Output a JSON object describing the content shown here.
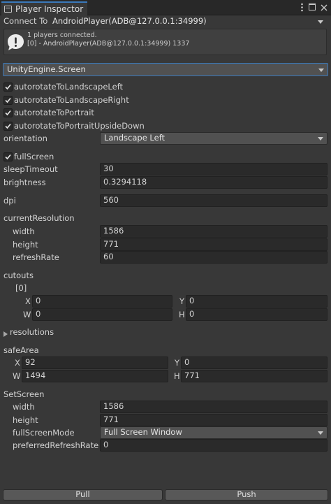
{
  "window": {
    "tab_title": "Player Inspector",
    "menu_icon": "kebab-menu-icon",
    "maximize_icon": "maximize-icon",
    "close_icon": "close-icon"
  },
  "connect": {
    "label": "Connect To",
    "value": "AndroidPlayer(ADB@127.0.0.1:34999)"
  },
  "message": {
    "icon": "warning-icon",
    "line1": "1 players connected.",
    "line2": "[0] - AndroidPlayer(ADB@127.0.0.1:34999) 1337"
  },
  "object_select": {
    "value": "UnityEngine.Screen"
  },
  "toggles": [
    {
      "label": "autorotateToLandscapeLeft",
      "checked": true
    },
    {
      "label": "autorotateToLandscapeRight",
      "checked": true
    },
    {
      "label": "autorotateToPortrait",
      "checked": true
    },
    {
      "label": "autorotateToPortraitUpsideDown",
      "checked": true
    }
  ],
  "orientation": {
    "label": "orientation",
    "value": "Landscape Left"
  },
  "fullScreen": {
    "label": "fullScreen",
    "checked": true
  },
  "sleepTimeout": {
    "label": "sleepTimeout",
    "value": "30"
  },
  "brightness": {
    "label": "brightness",
    "value": "0.3294118"
  },
  "dpi": {
    "label": "dpi",
    "value": "560"
  },
  "currentResolution": {
    "label": "currentResolution",
    "width": {
      "label": "width",
      "value": "1586"
    },
    "height": {
      "label": "height",
      "value": "771"
    },
    "refreshRate": {
      "label": "refreshRate",
      "value": "60"
    }
  },
  "cutouts": {
    "label": "cutouts",
    "item_label": "[0]",
    "x": {
      "label": "X",
      "value": "0"
    },
    "y": {
      "label": "Y",
      "value": "0"
    },
    "w": {
      "label": "W",
      "value": "0"
    },
    "h": {
      "label": "H",
      "value": "0"
    }
  },
  "resolutions": {
    "label": "resolutions",
    "expanded": false
  },
  "safeArea": {
    "label": "safeArea",
    "x": {
      "label": "X",
      "value": "92"
    },
    "y": {
      "label": "Y",
      "value": "0"
    },
    "w": {
      "label": "W",
      "value": "1494"
    },
    "h": {
      "label": "H",
      "value": "771"
    }
  },
  "setScreen": {
    "label": "SetScreen",
    "width": {
      "label": "width",
      "value": "1586"
    },
    "height": {
      "label": "height",
      "value": "771"
    },
    "fullScreenMode": {
      "label": "fullScreenMode",
      "value": "Full Screen Window"
    },
    "preferredRefreshRate": {
      "label": "preferredRefreshRate",
      "value": "0"
    }
  },
  "buttons": {
    "pull": "Pull",
    "push": "Push"
  },
  "colors": {
    "accent": "#3a79bb",
    "background": "#383838",
    "field": "#2a2a2a"
  }
}
